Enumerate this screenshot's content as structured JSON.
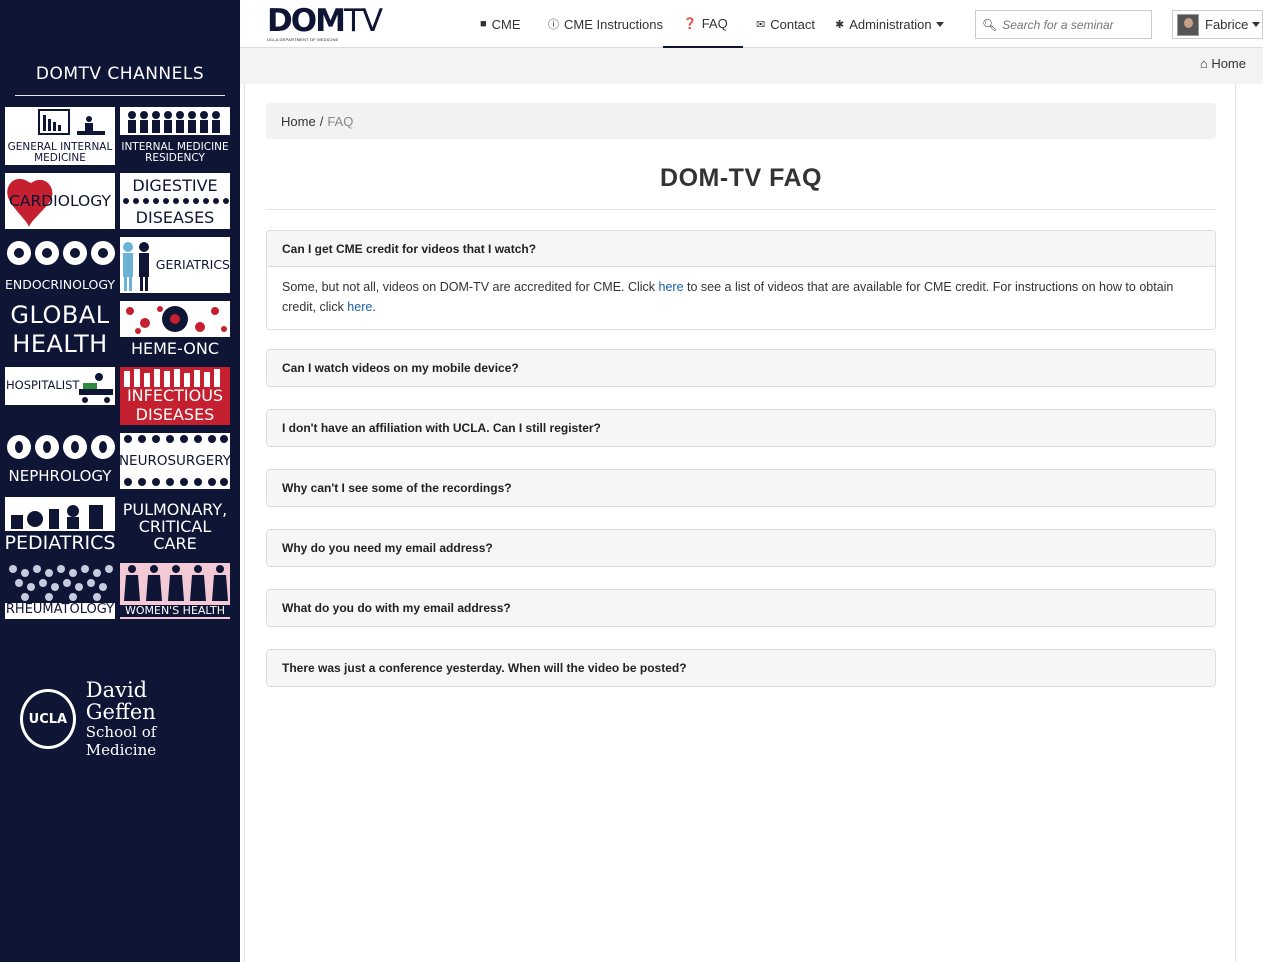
{
  "sidebar": {
    "title": "DOMTV CHANNELS",
    "channels": [
      {
        "label": "GENERAL INTERNAL\nMEDICINE"
      },
      {
        "label": "INTERNAL MEDICINE\nRESIDENCY"
      },
      {
        "label": "CARDIOLOGY"
      },
      {
        "label": "DIGESTIVE\nDISEASES"
      },
      {
        "label": "ENDOCRINOLOGY"
      },
      {
        "label": "GERIATRICS"
      },
      {
        "label": "GLOBAL\nHEALTH"
      },
      {
        "label": "HEME-ONC"
      },
      {
        "label": "HOSPITALIST"
      },
      {
        "label": "INFECTIOUS\nDISEASES"
      },
      {
        "label": "NEPHROLOGY"
      },
      {
        "label": "NEUROSURGERY"
      },
      {
        "label": "PEDIATRICS"
      },
      {
        "label": "PULMONARY,\nCRITICAL CARE"
      },
      {
        "label": "RHEUMATOLOGY"
      },
      {
        "label": "WOMEN'S HEALTH"
      }
    ],
    "footer_logo": {
      "seal": "UCLA",
      "line1": "David Geffen",
      "line2": "School of Medicine"
    }
  },
  "header": {
    "brand": {
      "main": "DOM",
      "tv": "TV",
      "sub": "UCLA DEPARTMENT OF MEDICINE"
    },
    "nav": [
      {
        "label": "CME",
        "icon": "video-camera-icon"
      },
      {
        "label": "CME Instructions",
        "icon": "info-circle-icon"
      },
      {
        "label": "FAQ",
        "icon": "question-circle-icon"
      },
      {
        "label": "Contact",
        "icon": "envelope-icon"
      },
      {
        "label": "Administration",
        "icon": "asterisk-icon"
      }
    ],
    "search": {
      "placeholder": "Search for a seminar"
    },
    "user": {
      "name": "Fabrice"
    }
  },
  "subbar": {
    "home_label": "Home"
  },
  "breadcrumb": {
    "home": "Home",
    "separator": "/",
    "current": "FAQ"
  },
  "page": {
    "title": "DOM-TV FAQ"
  },
  "faqs": [
    {
      "question": "Can I get CME credit for videos that I watch?",
      "answer_parts": {
        "a1": "Some, but not all, videos on DOM-TV are accredited for CME. Click ",
        "link1": "here",
        "a2": " to see a list of videos that are available for CME credit. For instructions on how to obtain credit, click ",
        "link2": "here",
        "a3": "."
      }
    },
    {
      "question": "Can I watch videos on my mobile device?"
    },
    {
      "question": "I don't have an affiliation with UCLA. Can I still register?"
    },
    {
      "question": "Why can't I see some of the recordings?"
    },
    {
      "question": "Why do you need my email address?"
    },
    {
      "question": "What do you do with my email address?"
    },
    {
      "question": "There was just a conference yesterday. When will the video be posted?"
    }
  ],
  "colors": {
    "navy": "#0f1535",
    "red": "#c4202f",
    "link": "#1a5fa8"
  }
}
